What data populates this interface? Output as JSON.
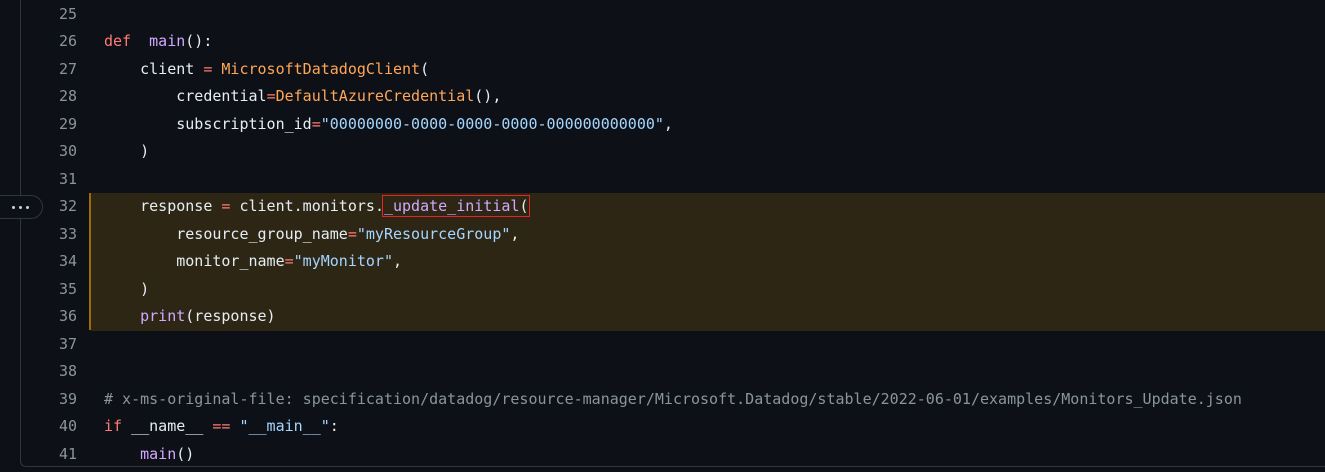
{
  "lines": [
    {
      "num": "25",
      "seg": []
    },
    {
      "num": "26",
      "seg": [
        [
          "kw",
          "def"
        ],
        [
          "",
          "  "
        ],
        [
          "fn",
          "main"
        ],
        [
          "",
          "():"
        ]
      ]
    },
    {
      "num": "27",
      "seg": [
        [
          "",
          "    client "
        ],
        [
          "op",
          "="
        ],
        [
          "",
          " "
        ],
        [
          "cls",
          "MicrosoftDatadogClient"
        ],
        [
          "",
          "("
        ]
      ]
    },
    {
      "num": "28",
      "seg": [
        [
          "",
          "        credential"
        ],
        [
          "op",
          "="
        ],
        [
          "cls",
          "DefaultAzureCredential"
        ],
        [
          "",
          "(),"
        ]
      ]
    },
    {
      "num": "29",
      "seg": [
        [
          "",
          "        subscription_id"
        ],
        [
          "op",
          "="
        ],
        [
          "str",
          "\"00000000-0000-0000-0000-000000000000\""
        ],
        [
          "",
          ","
        ]
      ]
    },
    {
      "num": "30",
      "seg": [
        [
          "",
          "    )"
        ]
      ]
    },
    {
      "num": "31",
      "seg": []
    },
    {
      "num": "32",
      "seg": [
        [
          "",
          "    response "
        ],
        [
          "op",
          "="
        ],
        [
          "",
          " client.monitors"
        ],
        [
          "fnmark",
          "._update_initial("
        ]
      ]
    },
    {
      "num": "33",
      "seg": [
        [
          "",
          "        resource_group_name"
        ],
        [
          "op",
          "="
        ],
        [
          "str",
          "\"myResourceGroup\""
        ],
        [
          "",
          ","
        ]
      ]
    },
    {
      "num": "34",
      "seg": [
        [
          "",
          "        monitor_name"
        ],
        [
          "op",
          "="
        ],
        [
          "str",
          "\"myMonitor\""
        ],
        [
          "",
          ","
        ]
      ]
    },
    {
      "num": "35",
      "seg": [
        [
          "",
          "    )"
        ]
      ]
    },
    {
      "num": "36",
      "seg": [
        [
          "fn",
          "    print"
        ],
        [
          "",
          "(response)"
        ]
      ]
    },
    {
      "num": "37",
      "seg": []
    },
    {
      "num": "38",
      "seg": []
    },
    {
      "num": "39",
      "seg": [
        [
          "cm",
          "# x-ms-original-file: specification/datadog/resource-manager/Microsoft.Datadog/stable/2022-06-01/examples/Monitors_Update.json"
        ]
      ]
    },
    {
      "num": "40",
      "seg": [
        [
          "kw",
          "if"
        ],
        [
          "",
          " __name__ "
        ],
        [
          "op",
          "=="
        ],
        [
          "",
          " "
        ],
        [
          "str",
          "\"__main__\""
        ],
        [
          "",
          ":"
        ]
      ]
    },
    {
      "num": "41",
      "seg": [
        [
          "fn",
          "    main"
        ],
        [
          "",
          "()"
        ]
      ]
    }
  ],
  "highlight_lines": [
    "32",
    "33",
    "34",
    "35",
    "36"
  ],
  "expander_icon": "ellipsis-icon",
  "colors": {
    "keyword": "#ff7b72",
    "function": "#d2a8ff",
    "class": "#ffa657",
    "string": "#a5d6ff",
    "comment": "#8b949e",
    "highlight": "#2d2615",
    "annotation": "#e5252a"
  }
}
